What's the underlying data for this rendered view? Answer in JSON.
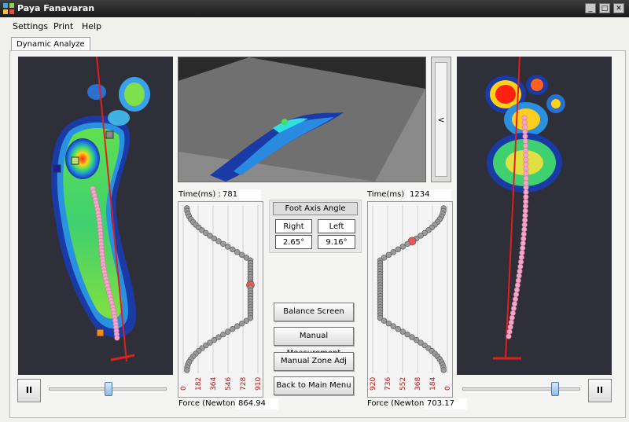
{
  "window": {
    "title": "Paya Fanavaran",
    "controls": [
      "_",
      "□",
      "✕"
    ]
  },
  "menu": [
    "Settings",
    "Print",
    "Help"
  ],
  "tab": "Dynamic Analyze",
  "view3d": {
    "scroll_label": "<"
  },
  "left_graph": {
    "time_label": "Time(ms) :",
    "time_value": "781",
    "force_label": "Force (Newton) :",
    "force_value": "864.94",
    "ticks": [
      "0",
      "182",
      "364",
      "546",
      "728",
      "910"
    ]
  },
  "right_graph": {
    "time_label": "Time(ms) :",
    "time_value": "1234",
    "force_label": "Force (Newton) :",
    "force_value": "703.17",
    "ticks": [
      "920",
      "736",
      "552",
      "368",
      "184",
      "0"
    ]
  },
  "foot_axis": {
    "header": "Foot Axis Angle",
    "right_label": "Right",
    "left_label": "Left",
    "right_value": "2.65°",
    "left_value": "9.16°"
  },
  "buttons": {
    "balance": "Balance Screen",
    "manual_measurement": "Manual Measurement",
    "manual_zone": "Manual Zone Adj",
    "back": "Back to Main Menu"
  },
  "playback": {
    "pause_label": "II"
  },
  "colors": {
    "panel_bg": "#2f2f39",
    "axis_line": "#e02020",
    "cop_point": "#f3a6c8",
    "force_point": "#9a9a9a"
  }
}
